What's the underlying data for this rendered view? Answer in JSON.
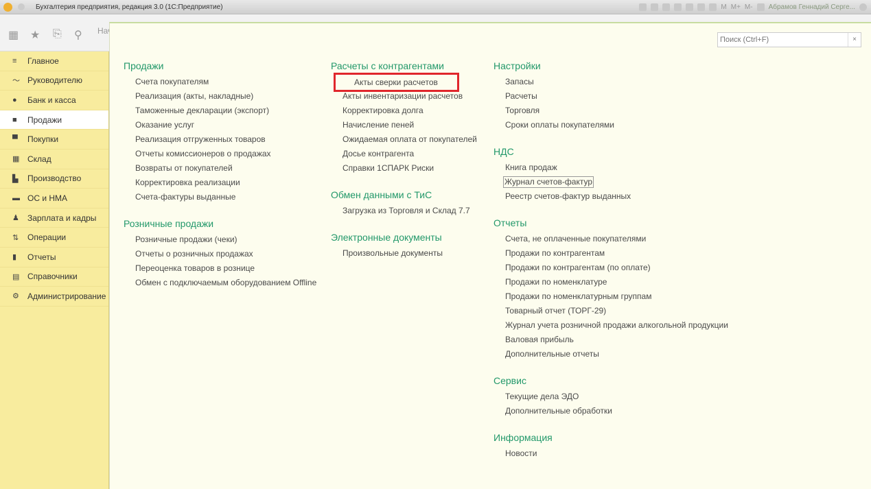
{
  "window": {
    "title": "Бухгалтерия предприятия, редакция 3.0 (1С:Предприятие)",
    "user": "Абрамов Геннадий Серге...",
    "memory_buttons": [
      "M",
      "M+",
      "M-"
    ],
    "logo_text": "1С"
  },
  "toolbar": {
    "start_tab": "Нач"
  },
  "search": {
    "placeholder": "Поиск (Ctrl+F)",
    "clear": "×"
  },
  "sidebar": {
    "items": [
      {
        "label": "Главное",
        "icon": "≡"
      },
      {
        "label": "Руководителю",
        "icon": "〜"
      },
      {
        "label": "Банк и касса",
        "icon": "●"
      },
      {
        "label": "Продажи",
        "icon": "■"
      },
      {
        "label": "Покупки",
        "icon": "▀"
      },
      {
        "label": "Склад",
        "icon": "▦"
      },
      {
        "label": "Производство",
        "icon": "▙"
      },
      {
        "label": "ОС и НМА",
        "icon": "▬"
      },
      {
        "label": "Зарплата и кадры",
        "icon": "♟"
      },
      {
        "label": "Операции",
        "icon": "⇅"
      },
      {
        "label": "Отчеты",
        "icon": "▮"
      },
      {
        "label": "Справочники",
        "icon": "▤"
      },
      {
        "label": "Администрирование",
        "icon": "⚙"
      }
    ],
    "active": 3
  },
  "columns": [
    [
      {
        "title": "Продажи",
        "items": [
          "Счета покупателям",
          "Реализация (акты, накладные)",
          "Таможенные декларации (экспорт)",
          "Оказание услуг",
          "Реализация отгруженных товаров",
          "Отчеты комиссионеров о продажах",
          "Возвраты от покупателей",
          "Корректировка реализации",
          "Счета-фактуры выданные"
        ]
      },
      {
        "title": "Розничные продажи",
        "items": [
          "Розничные продажи (чеки)",
          "Отчеты о розничных продажах",
          "Переоценка товаров в рознице",
          "Обмен с подключаемым оборудованием Offline"
        ]
      }
    ],
    [
      {
        "title": "Расчеты с контрагентами",
        "items": [
          "Акты сверки расчетов",
          "Акты инвентаризации расчетов",
          "Корректировка долга",
          "Начисление пеней",
          "Ожидаемая оплата от покупателей",
          "Досье контрагента",
          "Справки 1СПАРК Риски"
        ]
      },
      {
        "title": "Обмен данными с ТиС",
        "items": [
          "Загрузка из Торговля и Склад 7.7"
        ]
      },
      {
        "title": "Электронные документы",
        "items": [
          "Произвольные документы"
        ]
      }
    ],
    [
      {
        "title": "Настройки",
        "items": [
          "Запасы",
          "Расчеты",
          "Торговля",
          "Сроки оплаты покупателями"
        ]
      },
      {
        "title": "НДС",
        "items": [
          "Книга продаж",
          "Журнал счетов-фактур",
          "Реестр счетов-фактур выданных"
        ]
      },
      {
        "title": "Отчеты",
        "items": [
          "Счета, не оплаченные покупателями",
          "Продажи по контрагентам",
          "Продажи по контрагентам (по оплате)",
          "Продажи по номенклатуре",
          "Продажи по номенклатурным группам",
          "Товарный отчет (ТОРГ-29)",
          "Журнал учета розничной продажи алкогольной продукции",
          "Валовая прибыль",
          "Дополнительные отчеты"
        ]
      },
      {
        "title": "Сервис",
        "items": [
          "Текущие дела ЭДО",
          "Дополнительные обработки"
        ]
      },
      {
        "title": "Информация",
        "items": [
          "Новости"
        ]
      }
    ]
  ],
  "highlighted_item": "Акты сверки расчетов",
  "focused_item": "Журнал счетов-фактур"
}
